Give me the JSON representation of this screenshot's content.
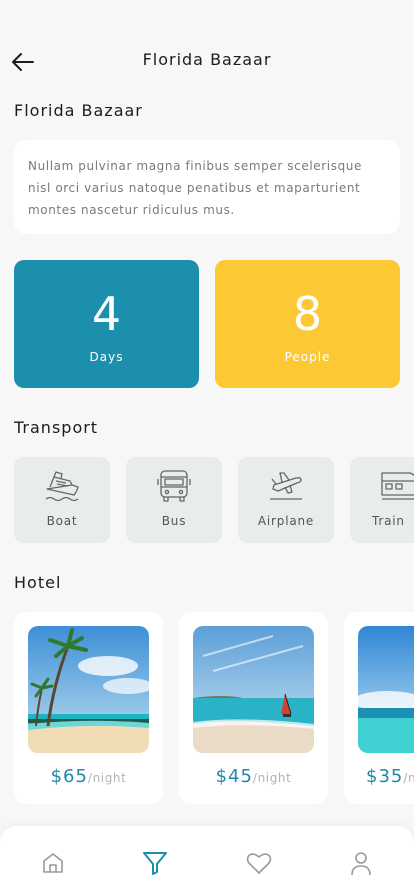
{
  "header": {
    "title": "Florida Bazaar"
  },
  "destination": {
    "title": "Florida Bazaar",
    "description": "Nullam pulvinar magna finibus semper scelerisque nisl orci varius natoque penatibus et maparturient montes nascetur ridiculus mus."
  },
  "stats": [
    {
      "value": "4",
      "label": "Days",
      "color": "#1c8fad"
    },
    {
      "value": "8",
      "label": "People",
      "color": "#fcc834"
    }
  ],
  "transport": {
    "title": "Transport",
    "items": [
      {
        "label": "Boat",
        "icon": "boat-icon"
      },
      {
        "label": "Bus",
        "icon": "bus-icon"
      },
      {
        "label": "Airplane",
        "icon": "airplane-icon"
      },
      {
        "label": "Train",
        "icon": "train-icon"
      }
    ]
  },
  "hotel": {
    "title": "Hotel",
    "items": [
      {
        "price": "$65",
        "unit": "/night"
      },
      {
        "price": "$45",
        "unit": "/night"
      },
      {
        "price": "$35",
        "unit": "/night"
      }
    ]
  },
  "nav": {
    "items": [
      {
        "icon": "home-icon",
        "active": false
      },
      {
        "icon": "filter-icon",
        "active": true
      },
      {
        "icon": "heart-icon",
        "active": false
      },
      {
        "icon": "profile-icon",
        "active": false
      }
    ],
    "active_color": "#1c8fad",
    "inactive_color": "#9a9a9a"
  }
}
